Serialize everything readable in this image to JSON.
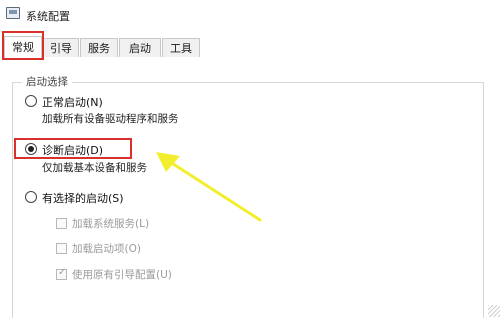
{
  "window": {
    "title": "系统配置"
  },
  "tabs": [
    {
      "label": "常规",
      "active": true
    },
    {
      "label": "引导",
      "active": false
    },
    {
      "label": "服务",
      "active": false
    },
    {
      "label": "启动",
      "active": false
    },
    {
      "label": "工具",
      "active": false
    }
  ],
  "startup": {
    "group_label": "启动选择",
    "normal": {
      "label": "正常启动(N)",
      "desc": "加载所有设备驱动程序和服务",
      "selected": false
    },
    "diagnostic": {
      "label": "诊断启动(D)",
      "desc": "仅加载基本设备和服务",
      "selected": true
    },
    "selective": {
      "label": "有选择的启动(S)",
      "selected": false,
      "options": [
        {
          "label": "加载系统服务(L)",
          "checked": false,
          "enabled": false
        },
        {
          "label": "加载启动项(O)",
          "checked": false,
          "enabled": false
        },
        {
          "label": "使用原有引导配置(U)",
          "checked": true,
          "enabled": false
        }
      ]
    }
  },
  "colors": {
    "highlight": "#d9302a",
    "arrow": "#f2ee2e"
  }
}
